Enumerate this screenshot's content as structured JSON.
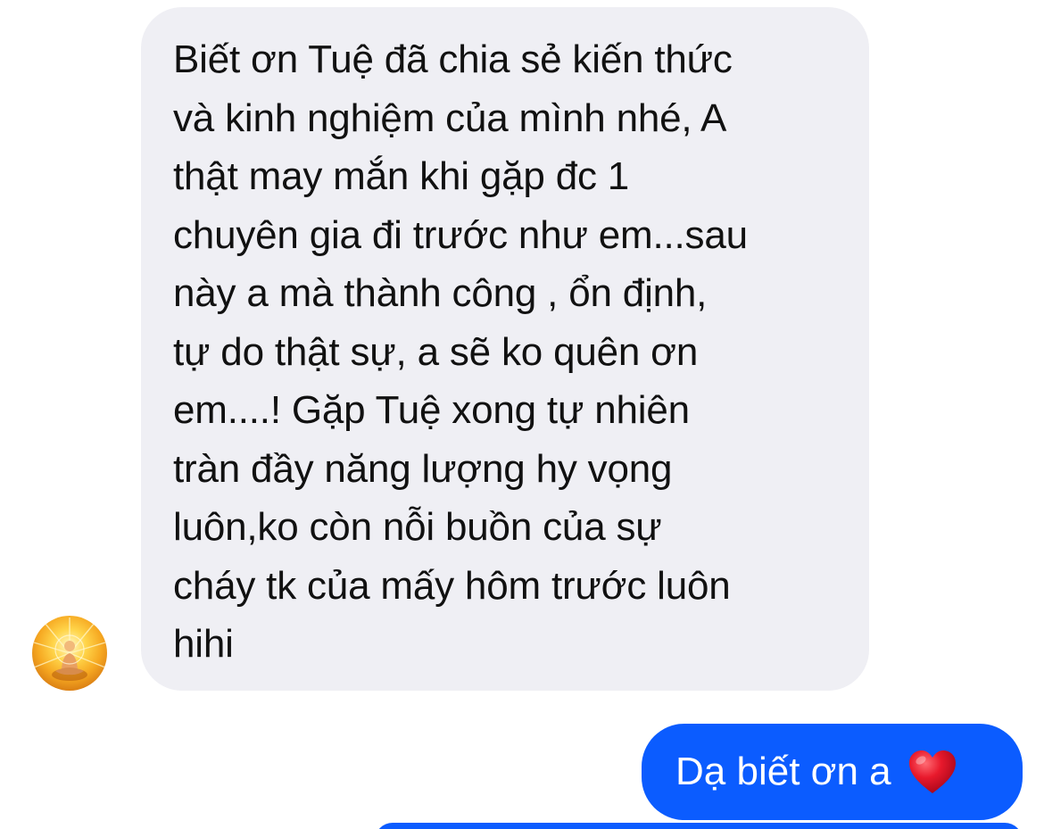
{
  "conversation": {
    "incoming": {
      "text": "Biết ơn Tuệ đã chia sẻ kiến thức\nvà kinh nghiệm của mình nhé, A\nthật may mắn khi gặp đc 1\nchuyên gia đi trước như em...sau\nnày a mà thành công , ổn định,\ntự do thật sự, a sẽ ko quên ơn\nem....! Gặp Tuệ xong tự nhiên\ntràn đầy năng lượng hy vọng\nluôn,ko còn nỗi buồn của sự\ncháy tk của mấy hôm trước luôn\nhihi",
      "avatar_icon": "meditating-figure-avatar"
    },
    "outgoing": {
      "text": "Dạ biết ơn a",
      "emoji_icon": "red-heart-icon"
    }
  },
  "colors": {
    "incoming_bubble": "#efeff4",
    "outgoing_bubble": "#0b5cff",
    "incoming_text": "#111111",
    "outgoing_text": "#ffffff",
    "heart": "#e8192c"
  }
}
